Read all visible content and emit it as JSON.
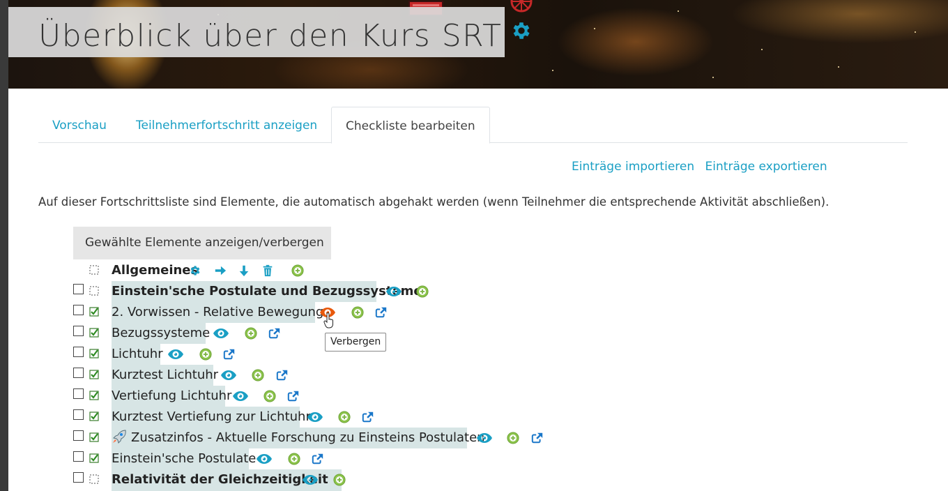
{
  "page": {
    "title": "Überblick über den Kurs SRT",
    "title_icon": "gear-icon"
  },
  "tabs": [
    {
      "label": "Vorschau",
      "active": false
    },
    {
      "label": "Teilnehmerfortschritt anzeigen",
      "active": false
    },
    {
      "label": "Checkliste bearbeiten",
      "active": true
    }
  ],
  "links": {
    "import": "Einträge importieren",
    "export": "Einträge exportieren"
  },
  "intro": "Auf dieser Fortschrittsliste sind Elemente, die automatisch abgehakt werden (wenn Teilnehmer die entsprechende Aktivität abschließen).",
  "toggle_button": "Gewählte Elemente anzeigen/verbergen",
  "tooltip": "Verbergen",
  "colors": {
    "accent": "#1a9fc4",
    "add_green": "#8bc34a",
    "highlight_eye": "#e8590c",
    "row_bg": "#d7e5e5"
  },
  "items": [
    {
      "label": "Allgemeines",
      "bold": true,
      "checkbox": false,
      "status": "pending",
      "actions": [
        "gear-icon",
        "arrow-right-icon",
        "arrow-down-icon",
        "trash-icon",
        "add-icon"
      ]
    },
    {
      "label": "Einstein'sche Postulate und Bezugssysteme",
      "bold": true,
      "checkbox": true,
      "status": "pending",
      "actions": [
        "eye-icon",
        "add-icon"
      ]
    },
    {
      "label": "2. Vorwissen - Relative Bewegung",
      "bold": false,
      "checkbox": true,
      "status": "done",
      "actions": [
        "eye-icon",
        "add-icon",
        "external-link-icon"
      ]
    },
    {
      "label": "Bezugssysteme",
      "bold": false,
      "checkbox": true,
      "status": "done",
      "actions": [
        "eye-icon",
        "add-icon",
        "external-link-icon"
      ]
    },
    {
      "label": "Lichtuhr",
      "bold": false,
      "checkbox": true,
      "status": "done",
      "actions": [
        "eye-icon",
        "add-icon",
        "external-link-icon"
      ]
    },
    {
      "label": "Kurztest Lichtuhr",
      "bold": false,
      "checkbox": true,
      "status": "done",
      "actions": [
        "eye-icon",
        "add-icon",
        "external-link-icon"
      ]
    },
    {
      "label": "Vertiefung Lichtuhr",
      "bold": false,
      "checkbox": true,
      "status": "done",
      "actions": [
        "eye-icon",
        "add-icon",
        "external-link-icon"
      ]
    },
    {
      "label": "Kurztest Vertiefung zur Lichtuhr",
      "bold": false,
      "checkbox": true,
      "status": "done",
      "actions": [
        "eye-icon",
        "add-icon",
        "external-link-icon"
      ]
    },
    {
      "label": "Zusatzinfos - Aktuelle Forschung zu Einsteins Postulaten",
      "bold": false,
      "checkbox": true,
      "status": "done",
      "prefix_icon": "rocket-icon",
      "actions": [
        "eye-icon",
        "add-icon",
        "external-link-icon"
      ]
    },
    {
      "label": "Einstein'sche Postulate",
      "bold": false,
      "checkbox": true,
      "status": "done",
      "actions": [
        "eye-icon",
        "add-icon",
        "external-link-icon"
      ]
    },
    {
      "label": "Relativität der Gleichzeitigkeit",
      "bold": true,
      "checkbox": true,
      "status": "pending",
      "actions": [
        "eye-icon",
        "add-icon"
      ]
    }
  ]
}
